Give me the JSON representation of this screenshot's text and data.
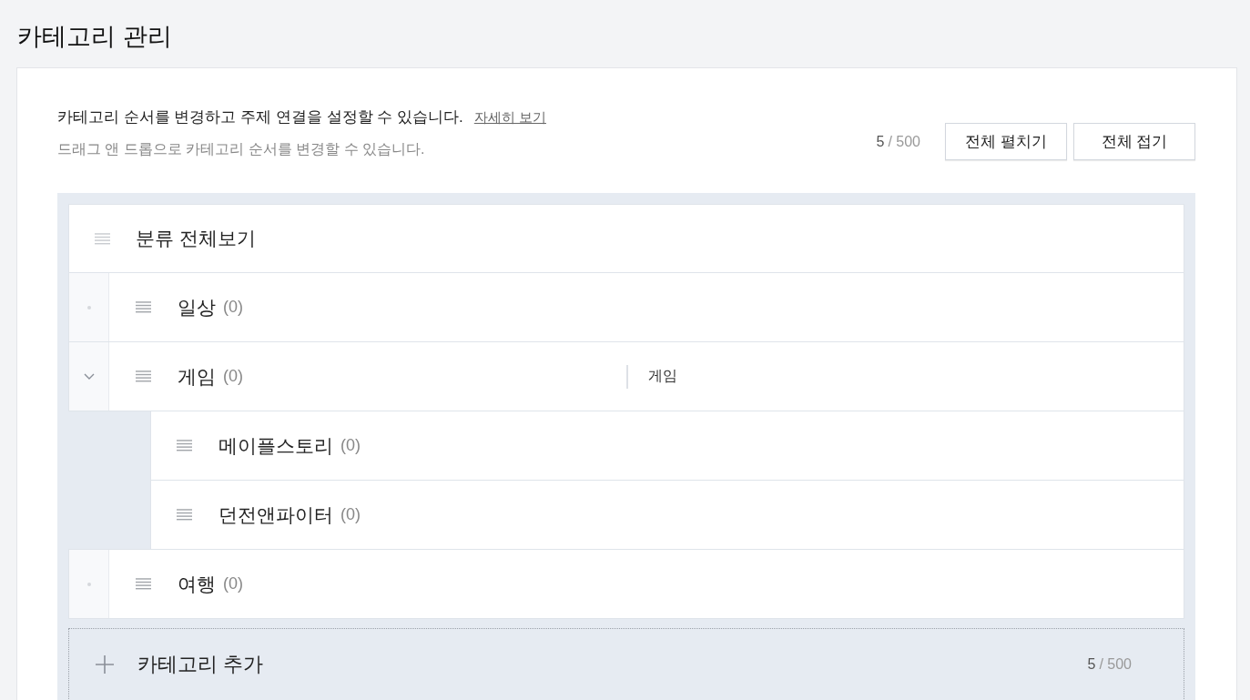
{
  "page_title": "카테고리 관리",
  "intro": {
    "text": "카테고리 순서를 변경하고 주제 연결을 설정할 수 있습니다.",
    "link": "자세히 보기",
    "hint": "드래그 앤 드롭으로 카테고리 순서를 변경할 수 있습니다."
  },
  "counter": {
    "current": "5",
    "limit": "/ 500"
  },
  "buttons": [
    "전체 펼치기",
    "전체 접기"
  ],
  "tree": {
    "root": {
      "label": "분류 전체보기"
    },
    "categories": [
      {
        "name": "일상",
        "count": "(0)",
        "expanded": false
      },
      {
        "name": "게임",
        "count": "(0)",
        "expanded": true,
        "topic": "게임",
        "children": [
          {
            "name": "메이플스토리",
            "count": "(0)"
          },
          {
            "name": "던전앤파이터",
            "count": "(0)"
          }
        ]
      },
      {
        "name": "여행",
        "count": "(0)",
        "expanded": false
      }
    ],
    "add_row": {
      "label": "카테고리 추가",
      "counter": {
        "current": "5",
        "limit": "/ 500"
      }
    }
  }
}
